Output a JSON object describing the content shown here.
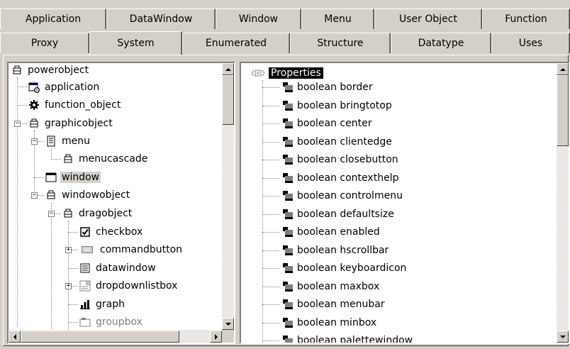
{
  "tabs_row1": [
    "Application",
    "DataWindow",
    "Window",
    "Menu",
    "User Object",
    "Function"
  ],
  "tabs_row2": [
    "Proxy",
    "System",
    "Enumerated",
    "Structure",
    "Datatype",
    "Uses"
  ],
  "active_tab": "System",
  "tree": {
    "root": "powerobject",
    "items": [
      "application",
      "function_object",
      "graphicobject",
      "menu",
      "menucascade",
      "window",
      "windowobject",
      "dragobject",
      "checkbox",
      "commandbutton",
      "datawindow",
      "dropdownlistbox",
      "graph",
      "groupbox"
    ],
    "selected": "window"
  },
  "properties": {
    "header": "Properties",
    "items": [
      "boolean border",
      "boolean bringtotop",
      "boolean center",
      "boolean clientedge",
      "boolean closebutton",
      "boolean contexthelp",
      "boolean controlmenu",
      "boolean defaultsize",
      "boolean enabled",
      "boolean hscrollbar",
      "boolean keyboardicon",
      "boolean maxbox",
      "boolean menubar",
      "boolean minbox",
      "boolean palettewindow"
    ]
  }
}
